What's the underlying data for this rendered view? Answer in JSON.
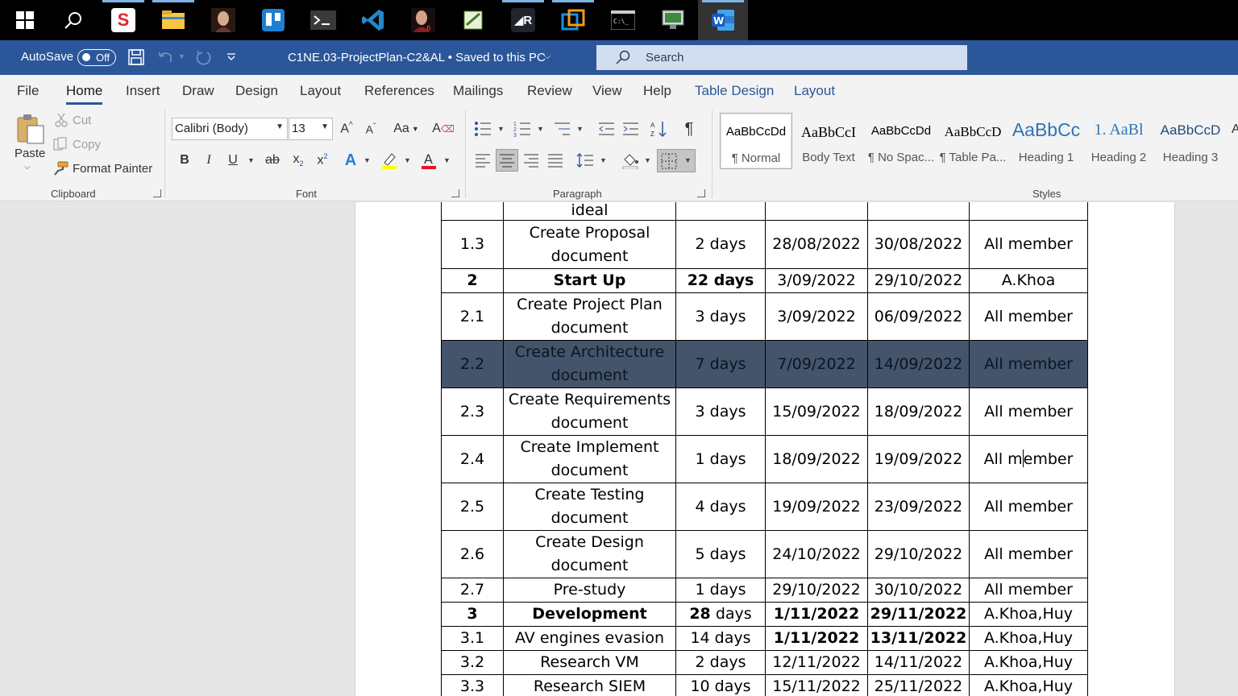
{
  "taskbar": {
    "apps": [
      {
        "icon": "windows-start-icon"
      },
      {
        "icon": "search-icon"
      },
      {
        "icon": "swiftkey-s-app-icon"
      },
      {
        "icon": "file-explorer-icon"
      },
      {
        "icon": "portrait-app-icon"
      },
      {
        "icon": "trello-icon"
      },
      {
        "icon": "terminal-app-icon"
      },
      {
        "icon": "vscode-icon"
      },
      {
        "icon": "portrait-app-2-icon"
      },
      {
        "icon": "notepad-app-icon"
      },
      {
        "icon": "r-app-icon"
      },
      {
        "icon": "virtual-app-icon"
      },
      {
        "icon": "cmd-icon"
      },
      {
        "icon": "remote-desktop-icon"
      },
      {
        "icon": "word-icon"
      }
    ]
  },
  "titlebar": {
    "autosave_label": "AutoSave",
    "autosave_state": "Off",
    "document_title": "C1NE.03-ProjectPlan-C2&AL • Saved to this PC",
    "search_placeholder": "Search",
    "accent_color": "#2b579a"
  },
  "ribbon_tabs": [
    "File",
    "Home",
    "Insert",
    "Draw",
    "Design",
    "Layout",
    "References",
    "Mailings",
    "Review",
    "View",
    "Help",
    "Table Design",
    "Layout"
  ],
  "clipboard": {
    "paste": "Paste",
    "cut": "Cut",
    "copy": "Copy",
    "format_painter": "Format Painter",
    "group_label": "Clipboard"
  },
  "font": {
    "family": "Calibri (Body)",
    "size": "13",
    "group_label": "Font",
    "font_color": "#e81123",
    "highlight_color": "#ffff00"
  },
  "paragraph": {
    "group_label": "Paragraph"
  },
  "styles": {
    "group_label": "Styles",
    "items": [
      {
        "preview": "AaBbCcDd",
        "name": "¶ Normal"
      },
      {
        "preview": "AaBbCcI",
        "name": "Body Text"
      },
      {
        "preview": "AaBbCcDd",
        "name": "¶ No Spac..."
      },
      {
        "preview": "AaBbCcD",
        "name": "¶ Table Pa..."
      },
      {
        "preview": "AaBbCc",
        "name": "Heading 1"
      },
      {
        "preview": "1. AaBl",
        "name": "Heading 2"
      },
      {
        "preview": "AaBbCcD",
        "name": "Heading 3"
      }
    ]
  },
  "table": {
    "rows": [
      {
        "num": "",
        "task": "ideal",
        "duration": "",
        "start": "",
        "end": "",
        "owner": ""
      },
      {
        "num": "1.3",
        "task": "Create Proposal document",
        "duration": "2 days",
        "start": "28/08/2022",
        "end": "30/08/2022",
        "owner": "All member"
      },
      {
        "num": "2",
        "task": "Start Up",
        "duration": "22 days",
        "start": "3/09/2022",
        "end": "29/10/2022",
        "owner": "A.Khoa"
      },
      {
        "num": "2.1",
        "task": "Create Project Plan document",
        "duration": "3 days",
        "start": "3/09/2022",
        "end": "06/09/2022",
        "owner": "All member"
      },
      {
        "num": "2.2",
        "task": "Create Architecture document",
        "duration": "7 days",
        "start": "7/09/2022",
        "end": "14/09/2022",
        "owner": "All member"
      },
      {
        "num": "2.3",
        "task": "Create Requirements document",
        "duration": "3 days",
        "start": "15/09/2022",
        "end": "18/09/2022",
        "owner": "All member"
      },
      {
        "num": "2.4",
        "task": "Create Implement document",
        "duration": "1 days",
        "start": "18/09/2022",
        "end": "19/09/2022",
        "owner_a": "All m",
        "owner_b": "ember"
      },
      {
        "num": "2.5",
        "task": "Create Testing document",
        "duration": "4 days",
        "start": "19/09/2022",
        "end": "23/09/2022",
        "owner": "All member"
      },
      {
        "num": "2.6",
        "task": "Create Design document",
        "duration": "5 days",
        "start": "24/10/2022",
        "end": "29/10/2022",
        "owner": "All member"
      },
      {
        "num": "2.7",
        "task": "Pre-study",
        "duration": "1 days",
        "start": "29/10/2022",
        "end": "30/10/2022",
        "owner": "All member"
      },
      {
        "num": "3",
        "task": "Development",
        "duration_num": "28",
        "duration_unit": " days",
        "start": "1/11/2022",
        "end": "29/11/2022",
        "owner": "A.Khoa,Huy"
      },
      {
        "num": "3.1",
        "task": "AV engines evasion",
        "duration": "14 days",
        "start": "1/11/2022",
        "end": "13/11/2022",
        "owner": "A.Khoa,Huy"
      },
      {
        "num": "3.2",
        "task": "Research VM",
        "duration": "2 days",
        "start": "12/11/2022",
        "end": "14/11/2022",
        "owner": "A.Khoa,Huy"
      },
      {
        "num": "3.3",
        "task": "Research SIEM",
        "duration": "10 days",
        "start": "15/11/2022",
        "end": "25/11/2022",
        "owner": "A.Khoa,Huy"
      }
    ],
    "selected_row_color": "#44546a"
  }
}
